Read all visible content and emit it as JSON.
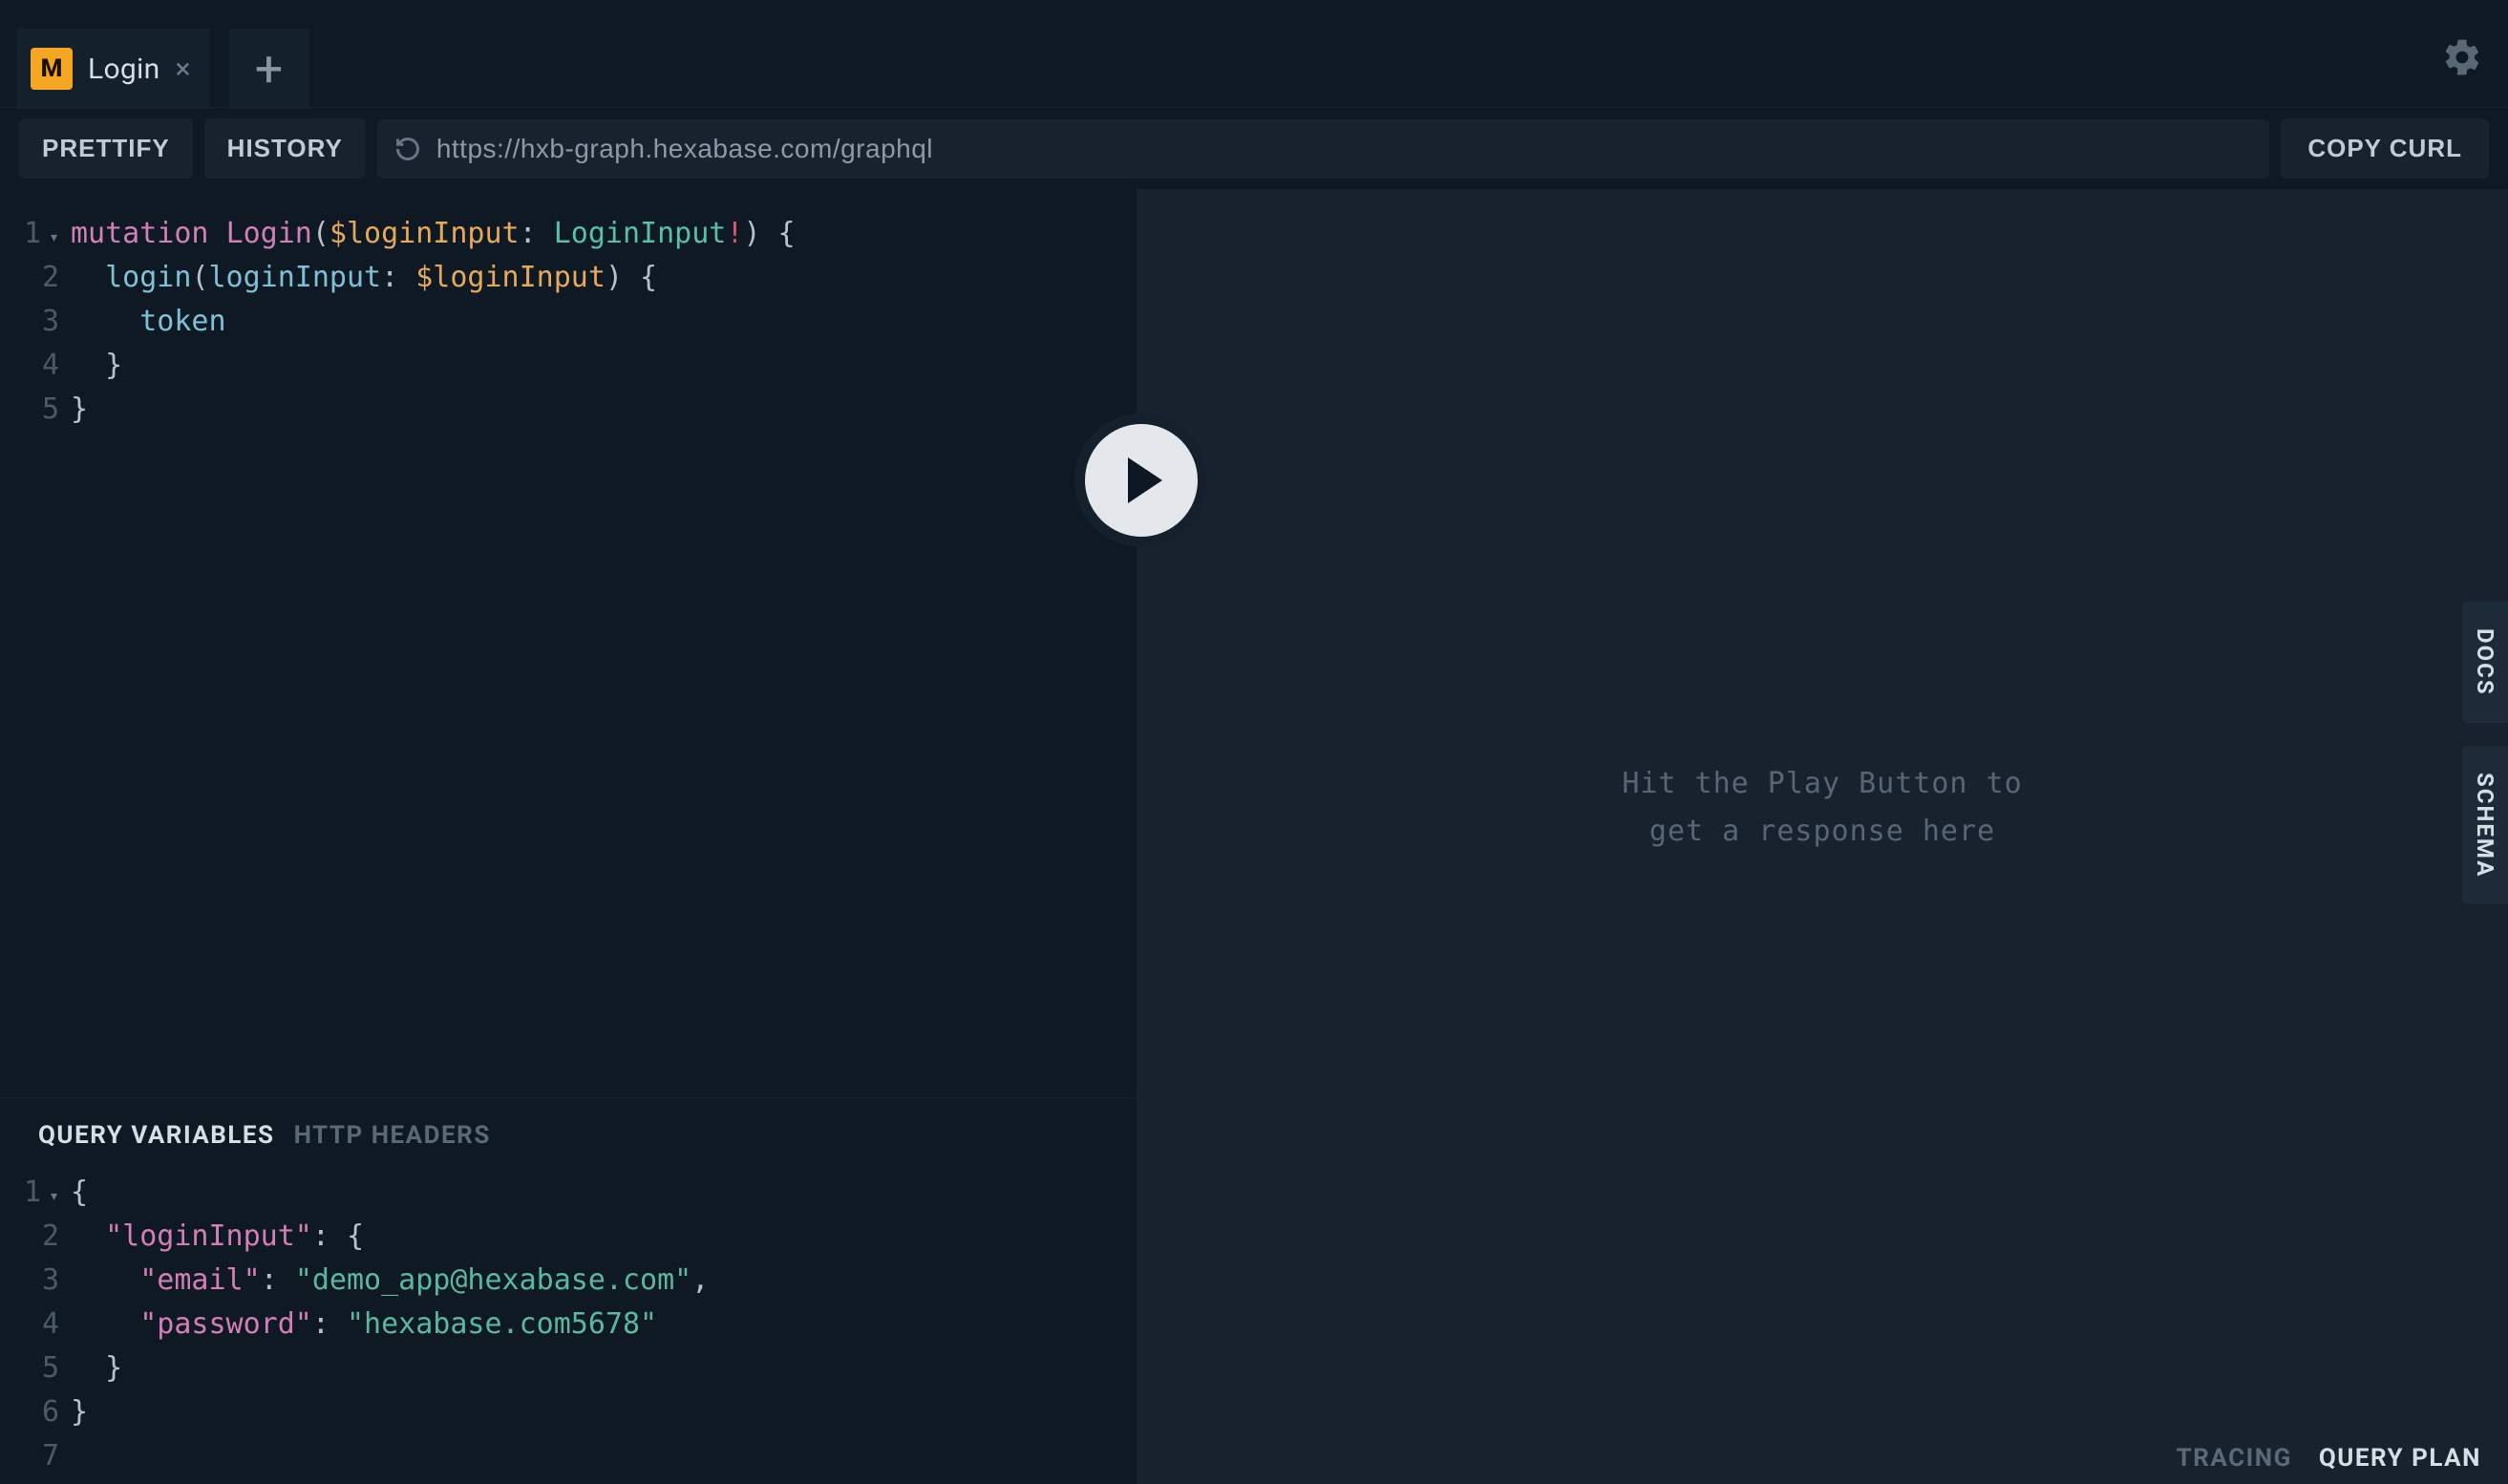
{
  "tabs": {
    "active": {
      "badge_letter": "M",
      "title": "Login"
    }
  },
  "toolbar": {
    "prettify": "PRETTIFY",
    "history": "HISTORY",
    "endpoint_value": "https://hxb-graph.hexabase.com/graphql",
    "copy_curl": "COPY CURL"
  },
  "query_editor": {
    "lines": [
      "1",
      "2",
      "3",
      "4",
      "5"
    ],
    "tokens": {
      "l1_kw": "mutation",
      "l1_name": "Login",
      "l1_var": "$loginInput",
      "l1_type": "LoginInput",
      "l2_field": "login",
      "l2_arg": "loginInput",
      "l2_var": "$loginInput",
      "l3_field": "token"
    }
  },
  "variables_pane": {
    "tab_vars": "QUERY VARIABLES",
    "tab_headers": "HTTP HEADERS",
    "lines": [
      "1",
      "2",
      "3",
      "4",
      "5",
      "6",
      "7"
    ],
    "tokens": {
      "l2_key": "\"loginInput\"",
      "l3_key": "\"email\"",
      "l3_val": "\"demo_app@hexabase.com\"",
      "l4_key": "\"password\"",
      "l4_val": "\"hexabase.com5678\""
    }
  },
  "response": {
    "placeholder_line1": "Hit the Play Button to",
    "placeholder_line2": "get a response here"
  },
  "side_tabs": {
    "docs": "DOCS",
    "schema": "SCHEMA"
  },
  "footer": {
    "tracing": "TRACING",
    "query_plan": "QUERY PLAN"
  },
  "colors": {
    "bg": "#0f1924",
    "panel": "#17222e",
    "accent": "#f5a623"
  }
}
